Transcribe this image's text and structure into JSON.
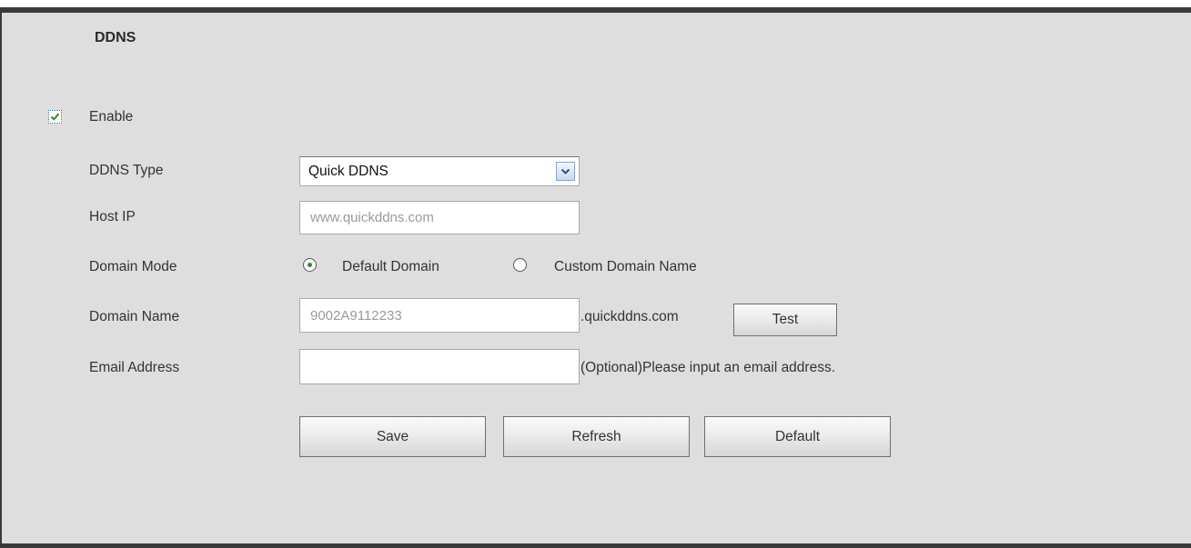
{
  "tab": {
    "label": "DDNS"
  },
  "form": {
    "enable": {
      "label": "Enable",
      "checked": true
    },
    "ddns_type": {
      "label": "DDNS Type",
      "value": "Quick DDNS"
    },
    "host_ip": {
      "label": "Host IP",
      "value": "www.quickddns.com"
    },
    "domain_mode": {
      "label": "Domain Mode",
      "options": [
        "Default Domain",
        "Custom Domain Name"
      ],
      "selected": "Default Domain"
    },
    "domain_name": {
      "label": "Domain Name",
      "value": "9002A9112233",
      "suffix": ".quickddns.com",
      "test_label": "Test"
    },
    "email": {
      "label": "Email Address",
      "value": "",
      "hint": "(Optional)Please input an email address."
    }
  },
  "actions": {
    "save": "Save",
    "refresh": "Refresh",
    "default": "Default"
  },
  "colors": {
    "frame": "#3a3a3a",
    "panel": "#dedede",
    "check": "#2e8b2e"
  },
  "icons": {
    "checkbox": "check-icon",
    "dropdown": "chevron-down-icon",
    "radio": "radio-dot-icon"
  }
}
